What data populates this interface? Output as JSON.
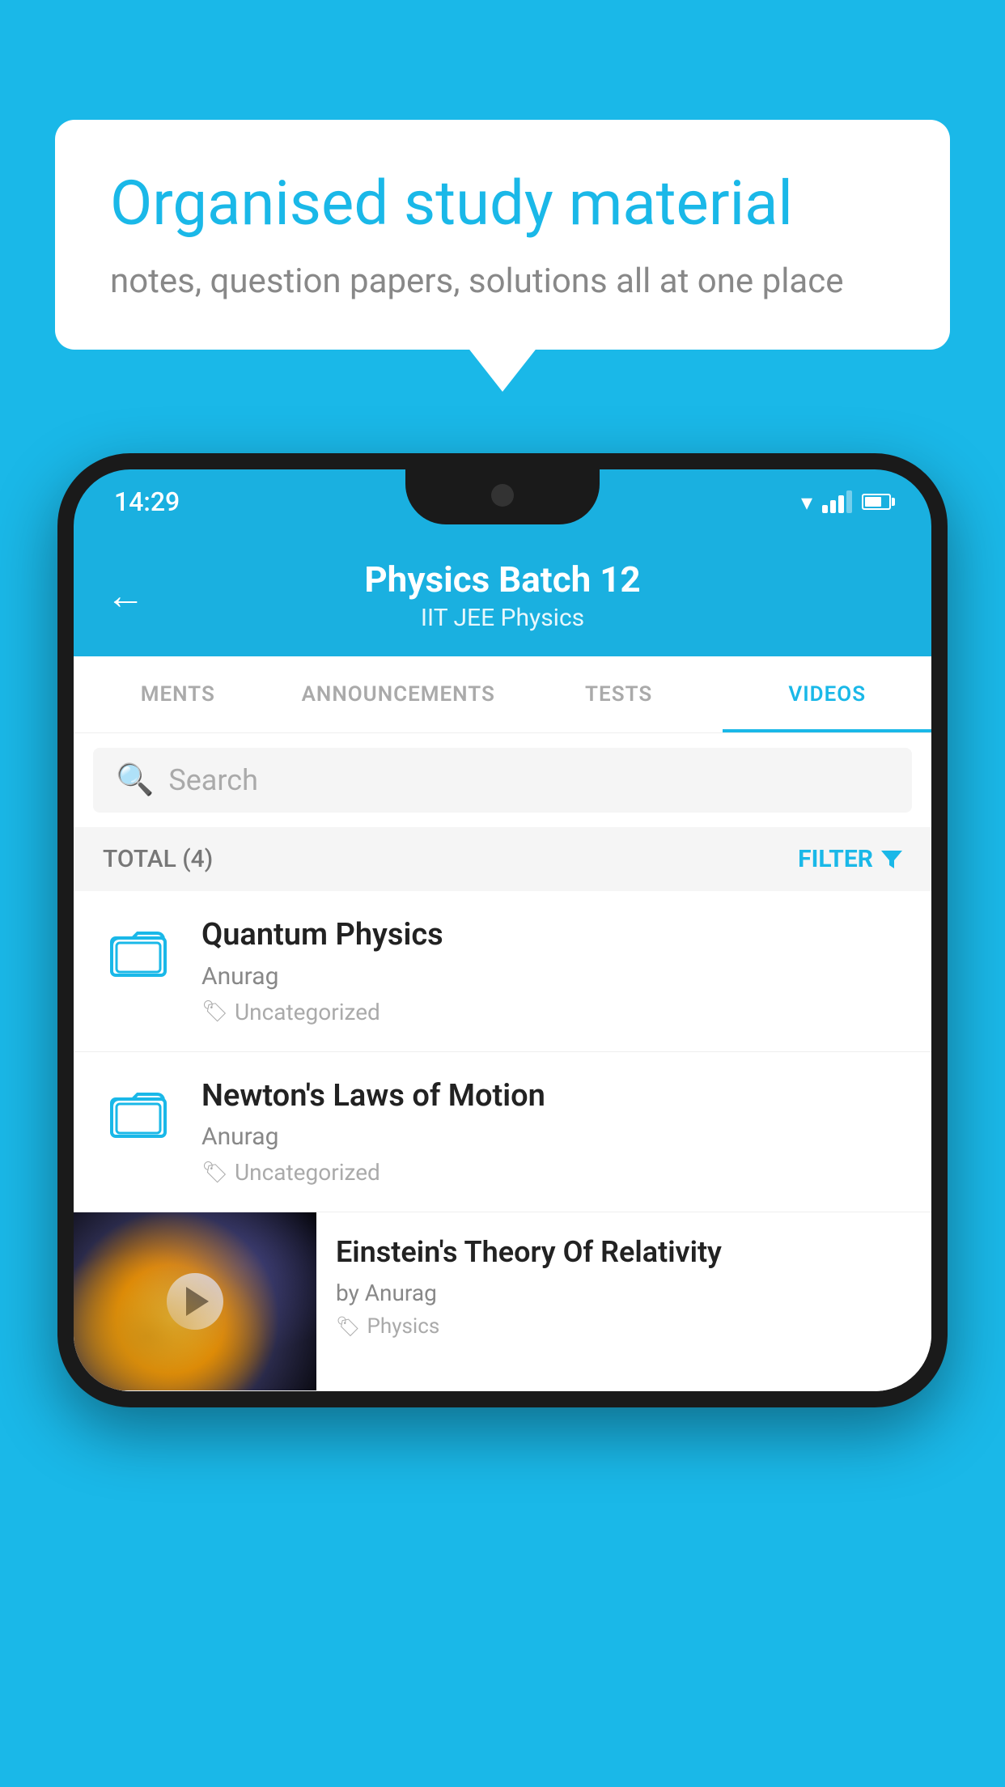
{
  "background_color": "#1ab8e8",
  "speech_bubble": {
    "title": "Organised study material",
    "subtitle": "notes, question papers, solutions all at one place"
  },
  "phone": {
    "status_bar": {
      "time": "14:29"
    },
    "app_header": {
      "back_label": "←",
      "title": "Physics Batch 12",
      "subtitle": "IIT JEE   Physics"
    },
    "tabs": [
      {
        "label": "MENTS",
        "active": false
      },
      {
        "label": "ANNOUNCEMENTS",
        "active": false
      },
      {
        "label": "TESTS",
        "active": false
      },
      {
        "label": "VIDEOS",
        "active": true
      }
    ],
    "search": {
      "placeholder": "Search"
    },
    "filter_bar": {
      "total_label": "TOTAL (4)",
      "filter_label": "FILTER"
    },
    "videos": [
      {
        "id": "quantum-physics",
        "title": "Quantum Physics",
        "author": "Anurag",
        "tag": "Uncategorized",
        "has_thumbnail": false
      },
      {
        "id": "newtons-laws",
        "title": "Newton's Laws of Motion",
        "author": "Anurag",
        "tag": "Uncategorized",
        "has_thumbnail": false
      },
      {
        "id": "einstein-relativity",
        "title": "Einstein's Theory Of Relativity",
        "author": "by Anurag",
        "tag": "Physics",
        "has_thumbnail": true
      }
    ]
  }
}
